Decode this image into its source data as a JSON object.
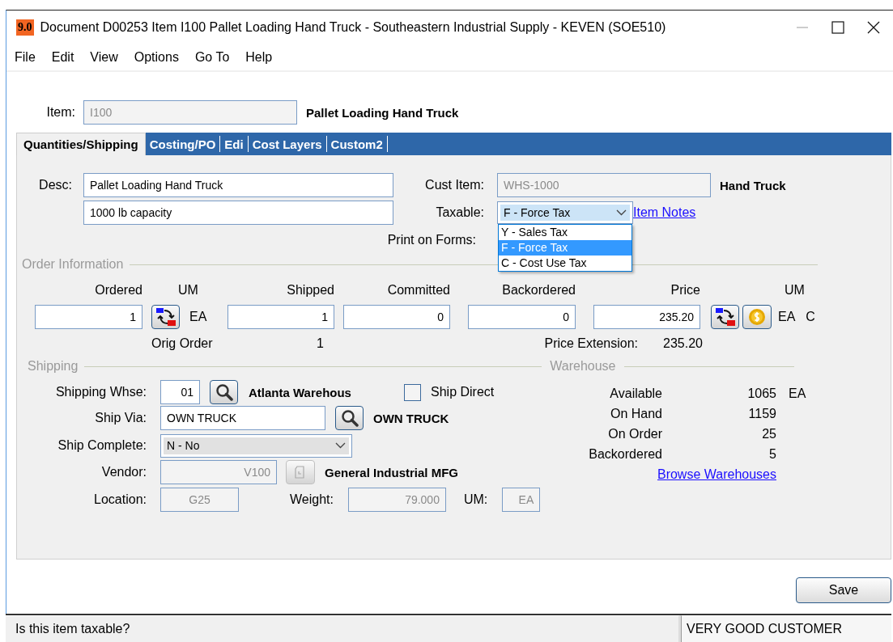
{
  "window": {
    "badge": "9.0",
    "title": "Document D00253 Item I100 Pallet Loading Hand Truck - Southeastern Industrial Supply - KEVEN (SOE510)"
  },
  "menu": [
    "File",
    "Edit",
    "View",
    "Options",
    "Go To",
    "Help"
  ],
  "item": {
    "label": "Item:",
    "value": "I100",
    "disabled": true,
    "description": "Pallet Loading Hand Truck"
  },
  "tabs": [
    {
      "label": "Quantities/Shipping",
      "selected": true
    },
    {
      "label": "Costing/PO",
      "selected": false
    },
    {
      "label": "Edi",
      "selected": false
    },
    {
      "label": "Cost Layers",
      "selected": false
    },
    {
      "label": "Custom2",
      "selected": false
    }
  ],
  "desc": {
    "label": "Desc:",
    "line_1": "Pallet Loading Hand Truck",
    "line_2": "1000 lb capacity"
  },
  "cust_item": {
    "label": "Cust Item:",
    "value": "WHS-1000",
    "disabled": true,
    "description": "Hand Truck"
  },
  "taxable": {
    "label": "Taxable:",
    "value": "F - Force Tax",
    "expanded": true,
    "options": [
      {
        "label": "Y - Sales Tax",
        "selected": false
      },
      {
        "label": "F - Force Tax",
        "selected": true
      },
      {
        "label": "C - Cost Use Tax",
        "selected": false
      }
    ]
  },
  "item_notes_link": "Item Notes",
  "print_on_forms_label": "Print on Forms:",
  "order": {
    "title": "Order Information",
    "ordered": {
      "label": "Ordered",
      "value": "1"
    },
    "um_label": "UM",
    "um": "EA",
    "shipped": {
      "label": "Shipped",
      "value": "1"
    },
    "committed": {
      "label": "Committed",
      "value": "0"
    },
    "backordered": {
      "label": "Backordered",
      "value": "0"
    },
    "price": {
      "label": "Price",
      "value": "235.20"
    },
    "price_um_label": "UM",
    "price_um": "EA",
    "price_code": "C",
    "orig_order": {
      "label": "Orig Order",
      "value": "1"
    },
    "price_extension": {
      "label": "Price Extension:",
      "value": "235.20"
    }
  },
  "shipping": {
    "title": "Shipping",
    "whse": {
      "label": "Shipping Whse:",
      "value": "01",
      "name": "Atlanta Warehous"
    },
    "ship_direct": {
      "label": "Ship Direct",
      "checked": false
    },
    "ship_via": {
      "label": "Ship Via:",
      "value": "OWN TRUCK",
      "name": "OWN TRUCK"
    },
    "ship_complete": {
      "label": "Ship Complete:",
      "value": "N - No"
    },
    "vendor": {
      "label": "Vendor:",
      "value": "V100",
      "disabled": true,
      "name": "General Industrial MFG"
    },
    "location": {
      "label": "Location:",
      "value": "G25",
      "disabled": true
    },
    "weight": {
      "label": "Weight:",
      "value": "79.000",
      "disabled": true
    },
    "weight_um": {
      "label": "UM:",
      "value": "EA",
      "disabled": true
    }
  },
  "warehouse": {
    "title": "Warehouse",
    "rows": [
      {
        "label": "Available",
        "value": "1065",
        "unit": "EA"
      },
      {
        "label": "On Hand",
        "value": "1159"
      },
      {
        "label": "On Order",
        "value": "25"
      },
      {
        "label": "Backordered",
        "value": "5"
      }
    ],
    "link": "Browse Warehouses"
  },
  "save_button": "Save",
  "status_bar": {
    "message": "Is this item taxable?",
    "customer": "VERY GOOD CUSTOMER"
  }
}
